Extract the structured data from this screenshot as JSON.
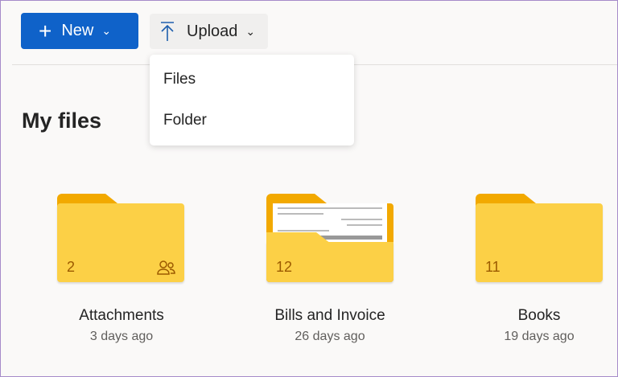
{
  "toolbar": {
    "new_label": "New",
    "upload_label": "Upload"
  },
  "upload_menu": {
    "items": [
      "Files",
      "Folder"
    ]
  },
  "page_title": "My files",
  "folders": [
    {
      "name": "Attachments",
      "modified": "3 days ago",
      "count": "2",
      "shared": true
    },
    {
      "name": "Bills and Invoice",
      "modified": "26 days ago",
      "count": "12",
      "shared": false
    },
    {
      "name": "Books",
      "modified": "19 days ago",
      "count": "11",
      "shared": false
    }
  ],
  "colors": {
    "accent": "#0f62c9",
    "folder": "#fcd046",
    "folder_back": "#f2a900"
  }
}
